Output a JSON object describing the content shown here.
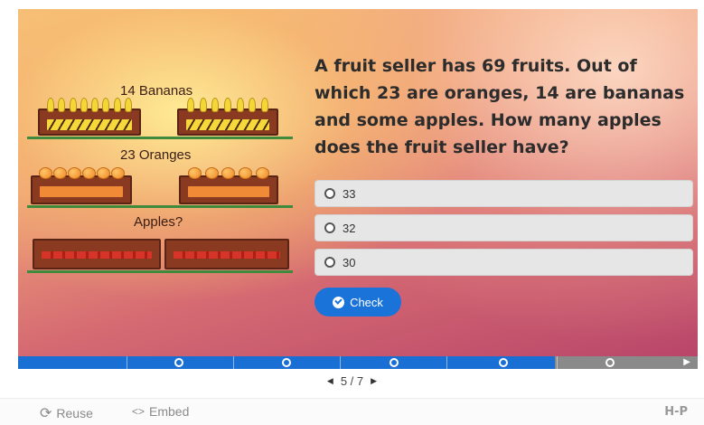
{
  "illustration": {
    "bananas_label": "14 Bananas",
    "oranges_label": "23 Oranges",
    "apples_label": "Apples?"
  },
  "question": {
    "text": "A fruit seller has 69 fruits. Out of which 23 are oranges, 14 are bananas and some apples. How many apples does the fruit seller have?",
    "answers": [
      "33",
      "32",
      "30"
    ],
    "check_label": "Check"
  },
  "progress": {
    "current": 5,
    "total": 7,
    "page_text": "5 / 7",
    "completed_fraction": 0.79
  },
  "footer": {
    "reuse_label": "Reuse",
    "embed_label": "Embed",
    "brand": "H-P"
  },
  "colors": {
    "accent": "#1a73d9",
    "progress_done": "#1a6fd4",
    "progress_todo": "#8a8a8a"
  }
}
